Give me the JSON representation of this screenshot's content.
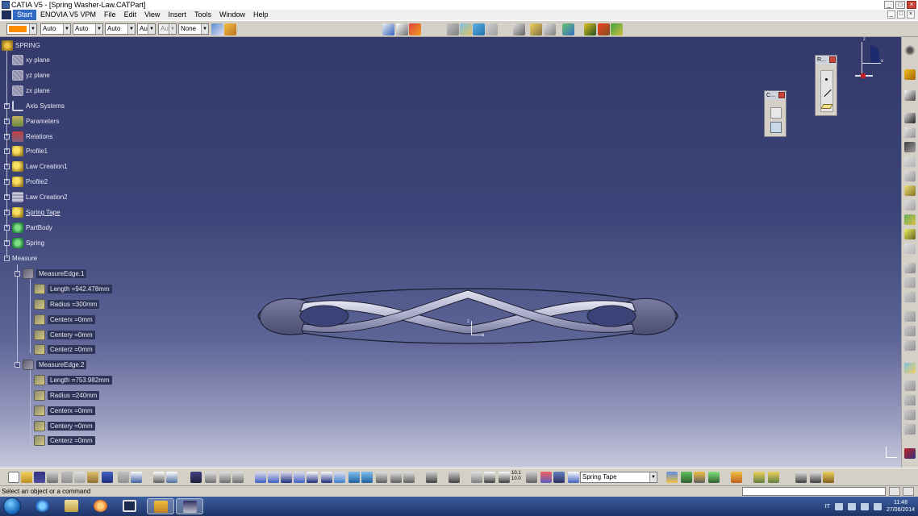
{
  "window": {
    "title": "CATIA V5 - [Spring Washer-Law.CATPart]",
    "minimize": "_",
    "restore": "□",
    "close": "×"
  },
  "menu": {
    "items": [
      "Start",
      "ENOVIA V5 VPM",
      "File",
      "Edit",
      "View",
      "Insert",
      "Tools",
      "Window",
      "Help"
    ]
  },
  "graphic_properties": {
    "color": "#ff8c00",
    "transparency": "Auto",
    "line_weight": "Auto",
    "line_type": "Auto",
    "point_type": "Aut",
    "layer_disabled": "Aut",
    "layer": "None"
  },
  "tree": {
    "root": "SPRING",
    "items": [
      {
        "label": "xy plane",
        "icon": "plane-icon"
      },
      {
        "label": "yz plane",
        "icon": "plane-icon"
      },
      {
        "label": "zx plane",
        "icon": "plane-icon"
      },
      {
        "label": "Axis Systems",
        "icon": "axis-icon"
      },
      {
        "label": "Parameters",
        "icon": "parameters-icon"
      },
      {
        "label": "Relations",
        "icon": "relations-icon"
      },
      {
        "label": "Profile1",
        "icon": "sketch-icon"
      },
      {
        "label": "Law Creation1",
        "icon": "sketch-icon"
      },
      {
        "label": "Profile2",
        "icon": "sketch-icon"
      },
      {
        "label": "Law Creation2",
        "icon": "law-icon"
      },
      {
        "label": "Spring Tape",
        "icon": "sketch-icon"
      },
      {
        "label": "PartBody",
        "icon": "body-icon"
      },
      {
        "label": "Spring",
        "icon": "body-icon"
      }
    ],
    "measure": {
      "label": "Measure",
      "edges": [
        {
          "label": "MeasureEdge.1",
          "values": [
            "Length =942.478mm",
            "Radius =300mm",
            "Centerx =0mm",
            "Centery =0mm",
            "Centerz =0mm"
          ]
        },
        {
          "label": "MeasureEdge.2",
          "values": [
            "Length =753.982mm",
            "Radius =240mm",
            "Centerx =0mm",
            "Centery =0mm",
            "Centerz =0mm"
          ]
        }
      ]
    }
  },
  "panels": {
    "c_panel": "C...",
    "r_panel": "R..."
  },
  "compass": {
    "z": "z",
    "x": "x"
  },
  "axis_triad": {
    "z": "z",
    "x": "x"
  },
  "bottom_toolbar": {
    "current_feature": "Spring Tape",
    "ratio_label": "10.1\n10.0"
  },
  "status": {
    "message": "Select an object or a command"
  },
  "taskbar": {
    "language": "IT",
    "time": "11:48",
    "date": "27/06/2014"
  }
}
